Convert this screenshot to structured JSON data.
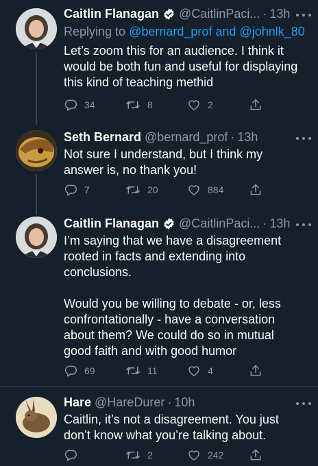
{
  "tweets": [
    {
      "name": "Caitlin Flanagan",
      "verified": true,
      "handle": "@CaitlinPaci...",
      "sep": "·",
      "time": "13h",
      "replying_prefix": "Replying to ",
      "replying_user1": "@bernard_prof",
      "replying_and": " and ",
      "replying_user2": "@johnlk_80",
      "text": "Let’s zoom this for an audience. I think it\nwould be both fun and useful for displaying\nthis kind of teaching methid",
      "replies": "34",
      "retweets": "8",
      "likes": "2"
    },
    {
      "name": "Seth Bernard",
      "verified": false,
      "handle": "@bernard_prof",
      "sep": "·",
      "time": "13h",
      "text": "Not sure I understand, but I think my\nanswer is, no thank you!",
      "replies": "7",
      "retweets": "20",
      "likes": "884"
    },
    {
      "name": "Caitlin Flanagan",
      "verified": true,
      "handle": "@CaitlinPaci...",
      "sep": "·",
      "time": "13h",
      "text": "I’m saying that we have a disagreement\nrooted in facts and extending into\nconclusions.\n\nWould you be willing to debate - or, less\nconfrontationally - have a conversation\nabout them?  We could do so in mutual\ngood faith and with good humor",
      "replies": "69",
      "retweets": "11",
      "likes": "4"
    },
    {
      "name": "Hare",
      "verified": false,
      "handle": "@HareDurer",
      "sep": "·",
      "time": "10h",
      "text": "Caitlin, it’s not a disagreement. You just\ndon’t know what you’re talking about.",
      "replies": "",
      "retweets": "2",
      "likes": "242"
    }
  ],
  "colors": {
    "background": "#15202b",
    "text": "#f7f9f9",
    "muted": "#8b98a5",
    "link": "#1d9bf0",
    "divider": "#38444d"
  },
  "icons": [
    "verified-badge-icon",
    "more-options-icon",
    "reply-icon",
    "retweet-icon",
    "like-icon",
    "share-icon"
  ]
}
